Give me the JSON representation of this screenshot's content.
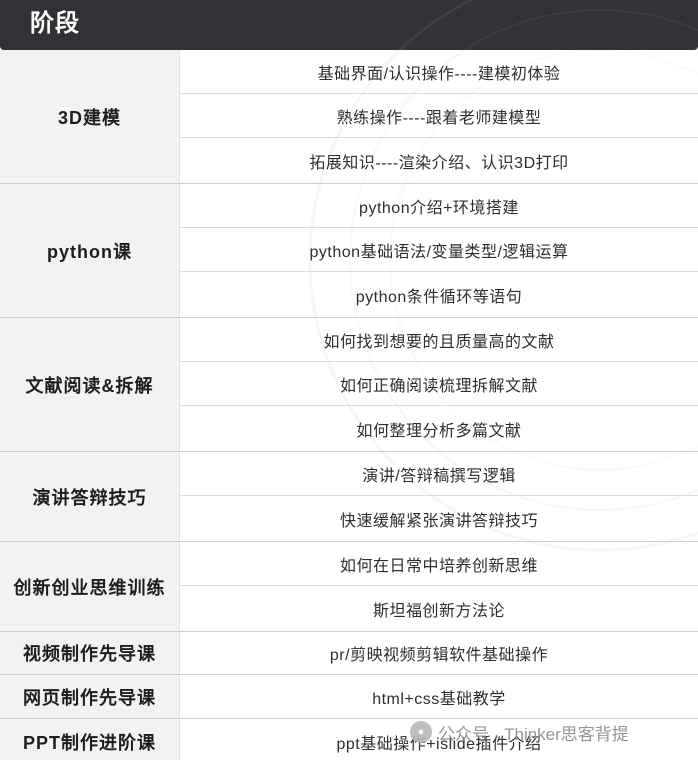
{
  "header": {
    "title": "阶段"
  },
  "stages": [
    {
      "name": "3D建模",
      "items": [
        "基础界面/认识操作----建模初体验",
        "熟练操作----跟着老师建模型",
        "拓展知识----渲染介绍、认识3D打印"
      ]
    },
    {
      "name": "python课",
      "items": [
        "python介绍+环境搭建",
        "python基础语法/变量类型/逻辑运算",
        "python条件循环等语句"
      ]
    },
    {
      "name": "文献阅读&拆解",
      "items": [
        "如何找到想要的且质量高的文献",
        "如何正确阅读梳理拆解文献",
        "如何整理分析多篇文献"
      ]
    },
    {
      "name": "演讲答辩技巧",
      "items": [
        "演讲/答辩稿撰写逻辑",
        "快速缓解紧张演讲答辩技巧"
      ]
    },
    {
      "name": "创新创业思维训练",
      "items": [
        "如何在日常中培养创新思维",
        "斯坦福创新方法论"
      ]
    },
    {
      "name": "视频制作先导课",
      "items": [
        "pr/剪映视频剪辑软件基础操作"
      ]
    },
    {
      "name": "网页制作先导课",
      "items": [
        "html+css基础教学"
      ]
    },
    {
      "name": "PPT制作进阶课",
      "items": [
        "ppt基础操作+islide插件介绍"
      ]
    }
  ],
  "watermark": {
    "text": "公众号 · Thinker思客背提",
    "icon": "wechat-icon"
  }
}
